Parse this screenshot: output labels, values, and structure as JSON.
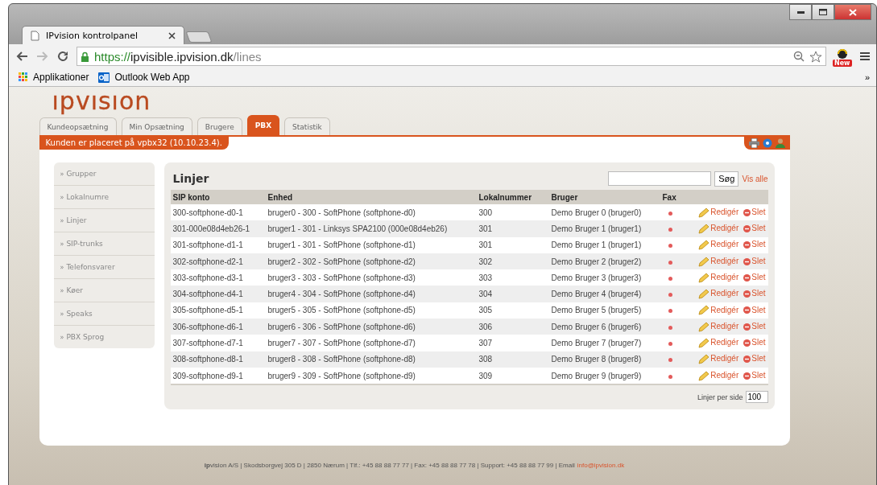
{
  "browser": {
    "tab_title": "IPvision kontrolpanel",
    "url_scheme": "https://",
    "url_host": "ipvisible.ipvision.dk",
    "url_path": "/lines",
    "extension_badge": "New",
    "bookmarks": [
      {
        "label": "Applikationer",
        "kind": "apps"
      },
      {
        "label": "Outlook Web App",
        "kind": "outlook"
      }
    ],
    "bookmarks_more": "»"
  },
  "logo": "ıpvısıon",
  "nav_tabs": [
    {
      "label": "Kundeopsætning",
      "selected": false
    },
    {
      "label": "Min Opsætning",
      "selected": false
    },
    {
      "label": "Brugere",
      "selected": false
    },
    {
      "label": "PBX",
      "selected": true
    },
    {
      "label": "Statistik",
      "selected": false
    }
  ],
  "notice": "Kunden er placeret på vpbx32 (10.10.23.4).",
  "sidebar": {
    "marker": "»",
    "items": [
      "Grupper",
      "Lokalnumre",
      "Linjer",
      "SIP-trunks",
      "Telefonsvarer",
      "Køer",
      "Speaks",
      "PBX Sprog"
    ]
  },
  "lines": {
    "title": "Linjer",
    "search_button": "Søg",
    "show_all": "Vis alle",
    "columns": [
      "SIP konto",
      "Enhed",
      "Lokalnummer",
      "Bruger",
      "Fax"
    ],
    "rows": [
      {
        "sip": "300-softphone-d0-1",
        "device": "bruger0 - 300 - SoftPhone (softphone-d0)",
        "ext": "300",
        "user": "Demo Bruger 0 (bruger0)",
        "fax": false,
        "edit": "Redigér",
        "delete": "Slet"
      },
      {
        "sip": "301-000e08d4eb26-1",
        "device": "bruger1 - 301 - Linksys SPA2100 (000e08d4eb26)",
        "ext": "301",
        "user": "Demo Bruger 1 (bruger1)",
        "fax": false,
        "edit": "Redigér",
        "delete": "Slet"
      },
      {
        "sip": "301-softphone-d1-1",
        "device": "bruger1 - 301 - SoftPhone (softphone-d1)",
        "ext": "301",
        "user": "Demo Bruger 1 (bruger1)",
        "fax": false,
        "edit": "Redigér",
        "delete": "Slet"
      },
      {
        "sip": "302-softphone-d2-1",
        "device": "bruger2 - 302 - SoftPhone (softphone-d2)",
        "ext": "302",
        "user": "Demo Bruger 2 (bruger2)",
        "fax": false,
        "edit": "Redigér",
        "delete": "Slet"
      },
      {
        "sip": "303-softphone-d3-1",
        "device": "bruger3 - 303 - SoftPhone (softphone-d3)",
        "ext": "303",
        "user": "Demo Bruger 3 (bruger3)",
        "fax": false,
        "edit": "Redigér",
        "delete": "Slet"
      },
      {
        "sip": "304-softphone-d4-1",
        "device": "bruger4 - 304 - SoftPhone (softphone-d4)",
        "ext": "304",
        "user": "Demo Bruger 4 (bruger4)",
        "fax": false,
        "edit": "Redigér",
        "delete": "Slet"
      },
      {
        "sip": "305-softphone-d5-1",
        "device": "bruger5 - 305 - SoftPhone (softphone-d5)",
        "ext": "305",
        "user": "Demo Bruger 5 (bruger5)",
        "fax": false,
        "edit": "Redigér",
        "delete": "Slet"
      },
      {
        "sip": "306-softphone-d6-1",
        "device": "bruger6 - 306 - SoftPhone (softphone-d6)",
        "ext": "306",
        "user": "Demo Bruger 6 (bruger6)",
        "fax": false,
        "edit": "Redigér",
        "delete": "Slet"
      },
      {
        "sip": "307-softphone-d7-1",
        "device": "bruger7 - 307 - SoftPhone (softphone-d7)",
        "ext": "307",
        "user": "Demo Bruger 7 (bruger7)",
        "fax": false,
        "edit": "Redigér",
        "delete": "Slet"
      },
      {
        "sip": "308-softphone-d8-1",
        "device": "bruger8 - 308 - SoftPhone (softphone-d8)",
        "ext": "308",
        "user": "Demo Bruger 8 (bruger8)",
        "fax": false,
        "edit": "Redigér",
        "delete": "Slet"
      },
      {
        "sip": "309-softphone-d9-1",
        "device": "bruger9 - 309 - SoftPhone (softphone-d9)",
        "ext": "309",
        "user": "Demo Bruger 9 (bruger9)",
        "fax": false,
        "edit": "Redigér",
        "delete": "Slet"
      }
    ],
    "per_page_label": "Linjer per side",
    "per_page": "100"
  },
  "footer": {
    "text": "**ip**vision A/S | Skodsborgvej 305 D | 2850 Nærum | Tlf.: +45 88 88 77 77 | Fax: +45 88 88 77 78 | Support: +45 88 88 77 99 | Email",
    "email": "info@ipvision.dk"
  }
}
